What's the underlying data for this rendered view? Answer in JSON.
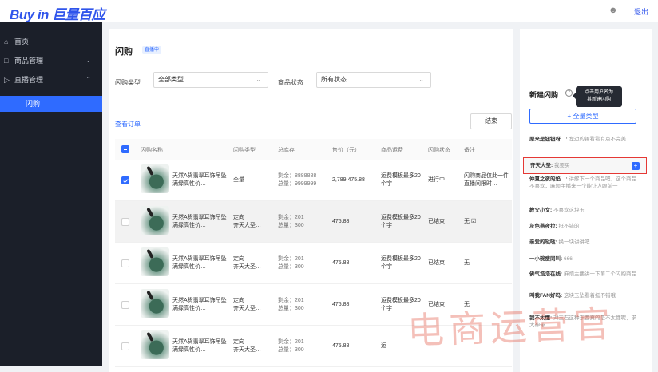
{
  "header": {
    "logo": "Buy in 巨量百应",
    "logout": "退出",
    "user_icon": "user-icon"
  },
  "sidebar": {
    "items": [
      {
        "label": "首页",
        "icon": "home-icon"
      },
      {
        "label": "商品管理",
        "icon": "bag-icon",
        "chevron": "⌄"
      },
      {
        "label": "直播管理",
        "icon": "live-icon",
        "chevron": "⌃"
      },
      {
        "label": "闪购"
      }
    ]
  },
  "main": {
    "title": "闪购",
    "live_tag": "直播中",
    "filters": {
      "type_label": "闪购类型",
      "type_value": "全部类型",
      "status_label": "商品状态",
      "status_value": "所有状态"
    },
    "orders_link": "查看订单",
    "end_button": "结束",
    "columns": [
      "闪购名称",
      "闪购类型",
      "总库存",
      "售价（元）",
      "商品运费",
      "闪购状态",
      "备注"
    ],
    "rows": [
      {
        "name": "天然A货翡翠耳饰吊坠满绿高性价…",
        "type": "全量",
        "type2": "",
        "stock_left": "剩余：8888888",
        "stock_total": "总量：9999999",
        "price": "2,789,475.88",
        "shipping": "运费模板最多20个字",
        "status": "进行中",
        "note": "闪购商品仅此一件直播间限时…",
        "checked": true
      },
      {
        "name": "天然A货翡翠耳饰吊坠满绿高性价…",
        "type": "定向",
        "type2": "齐天大圣…",
        "stock_left": "剩余：201",
        "stock_total": "总量：300",
        "price": "475.88",
        "shipping": "运费模板最多20个字",
        "status": "已结束",
        "note": "无 ☑",
        "checked": false
      },
      {
        "name": "天然A货翡翠耳饰吊坠满绿高性价…",
        "type": "定向",
        "type2": "齐天大圣…",
        "stock_left": "剩余：201",
        "stock_total": "总量：300",
        "price": "475.88",
        "shipping": "运费模板最多20个字",
        "status": "已结束",
        "note": "无",
        "checked": false
      },
      {
        "name": "天然A货翡翠耳饰吊坠满绿高性价…",
        "type": "定向",
        "type2": "齐天大圣…",
        "stock_left": "剩余：201",
        "stock_total": "总量：300",
        "price": "475.88",
        "shipping": "运费模板最多20个字",
        "status": "已结束",
        "note": "无",
        "checked": false
      },
      {
        "name": "天然A货翡翠耳饰吊坠满绿高性价…",
        "type": "定向",
        "type2": "齐天大圣…",
        "stock_left": "剩余：201",
        "stock_total": "总量：300",
        "price": "475.88",
        "shipping": "运",
        "status": "",
        "note": "",
        "checked": false
      }
    ]
  },
  "panel": {
    "title": "新建闪购",
    "tooltip_line1": "点击用户名为",
    "tooltip_line2": "其新建闪购",
    "add_button": "+ 全量类型",
    "comments": [
      {
        "user": "原来是钮钮呀…:",
        "text": "左边的镯看看有点不完美"
      },
      {
        "user": "齐天大圣:",
        "text": "我要买"
      },
      {
        "user": "仲夏之夜的焰…:",
        "text": "讲解下一个商品吧，这个商品不喜欢，麻烦主播来一个能让人眼前一"
      },
      {
        "user": "教父小文:",
        "text": "不喜欢这块玉"
      },
      {
        "user": "灰色燕夜拉:",
        "text": "挺不错的"
      },
      {
        "user": "亲爱的哒哒:",
        "text": "换一块讲讲吧"
      },
      {
        "user": "一小碗瘦同叫:",
        "text": "666"
      },
      {
        "user": "佛气浩浩在线:",
        "text": "麻烦主播讲一下第二个闪购商品"
      },
      {
        "user": "叫我FAN好吗:",
        "text": "这块玉坠看着挺不错哦"
      },
      {
        "user": "我不太懂:",
        "text": "对玉石这种东西真的是不太懂呢，求大神带"
      }
    ]
  },
  "watermark": "电商运营官"
}
